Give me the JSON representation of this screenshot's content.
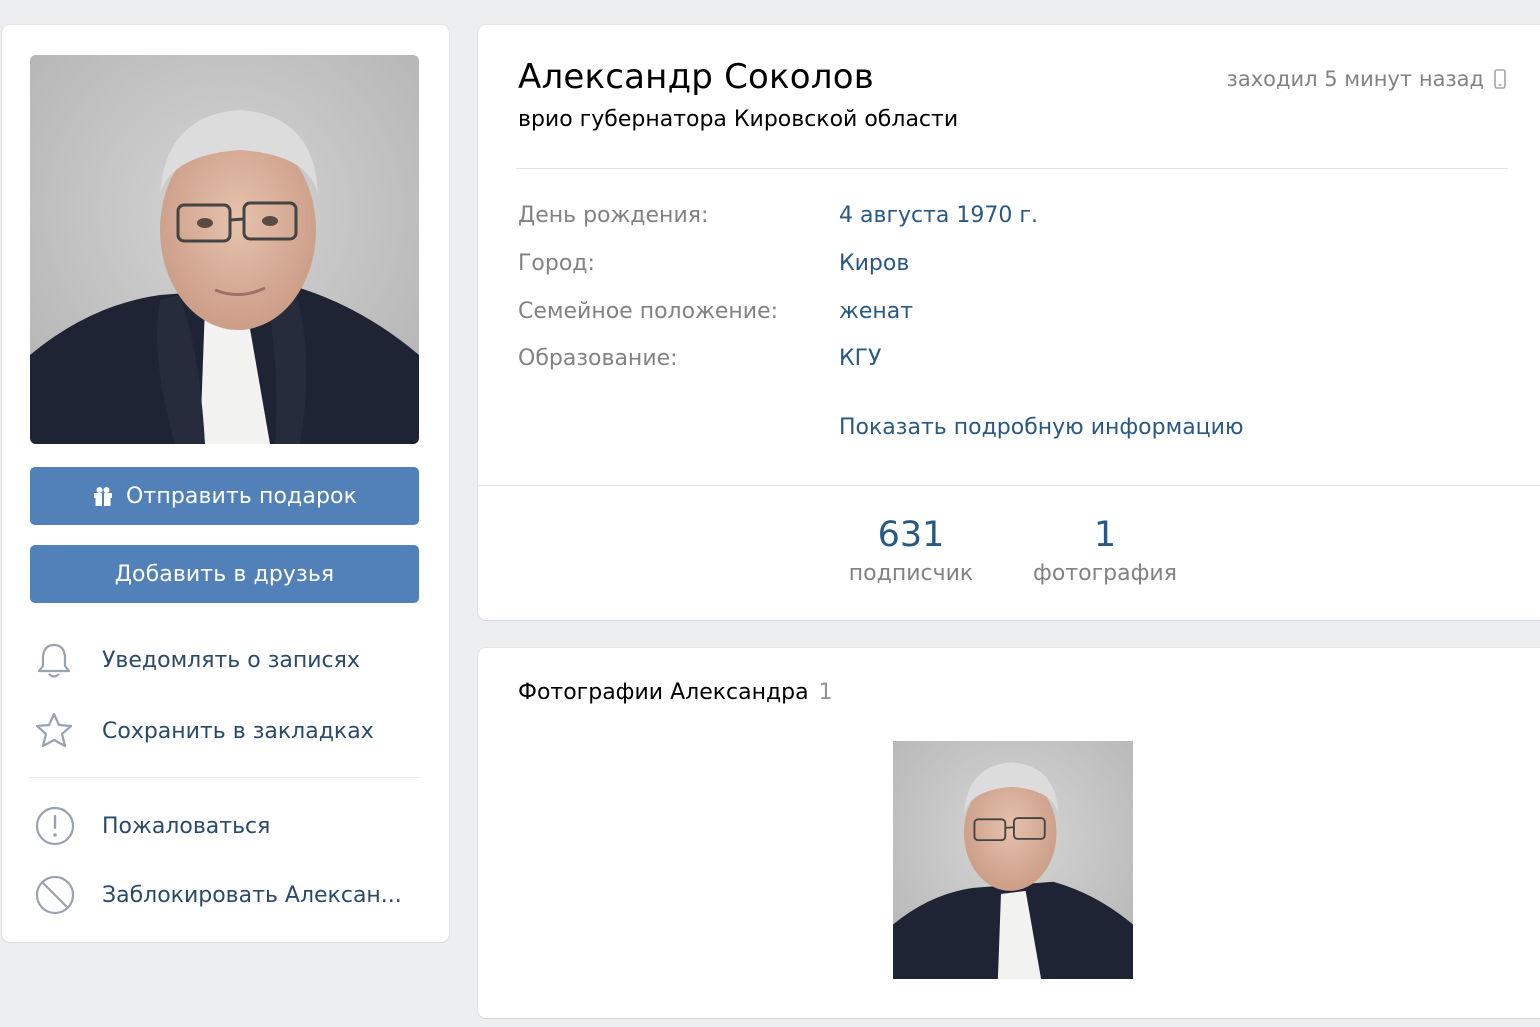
{
  "profile": {
    "name": "Александр Соколов",
    "status": "врио губернатора Кировской области",
    "online": "заходил 5 минут назад"
  },
  "actions": {
    "gift_label": "Отправить подарок",
    "add_friend_label": "Добавить в друзья",
    "notify_label": "Уведомлять о записях",
    "bookmark_label": "Сохранить в закладках",
    "report_label": "Пожаловаться",
    "block_label": "Заблокировать Алексан..."
  },
  "info": {
    "rows": [
      {
        "key": "День рождения:",
        "value": "4 августа 1970 г."
      },
      {
        "key": "Город:",
        "value": "Киров"
      },
      {
        "key": "Семейное положение:",
        "value": "женат"
      },
      {
        "key": "Образование:",
        "value": "КГУ"
      }
    ],
    "more_label": "Показать подробную информацию"
  },
  "counters": [
    {
      "num": "631",
      "caption": "подписчик"
    },
    {
      "num": "1",
      "caption": "фотография"
    }
  ],
  "photos": {
    "title": "Фотографии Александра",
    "count": "1"
  },
  "colors": {
    "accent": "#5181b8",
    "link": "#2a5885",
    "muted": "#828282",
    "background": "#edeef0"
  }
}
